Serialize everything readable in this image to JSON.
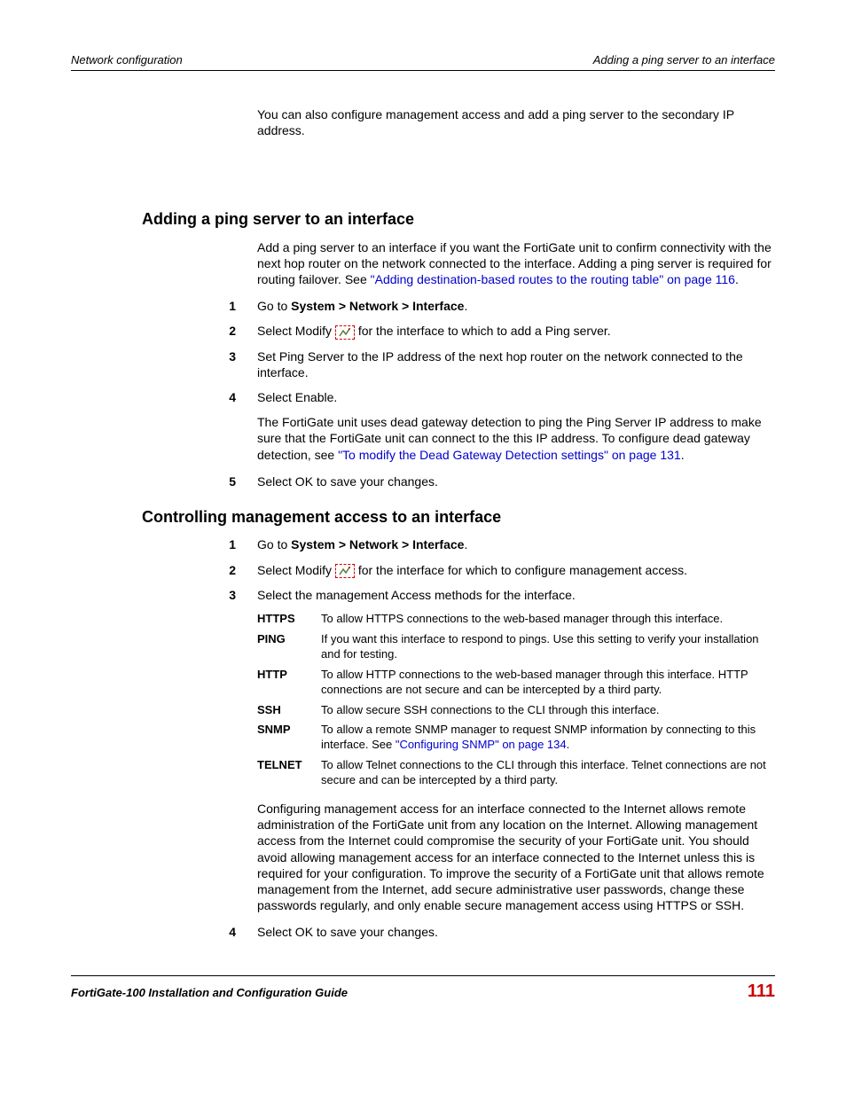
{
  "header": {
    "left": "Network configuration",
    "right": "Adding a ping server to an interface"
  },
  "intro": "You can also configure management access and add a ping server to the secondary IP address.",
  "section1": {
    "title": "Adding a ping server to an interface",
    "para_pre": "Add a ping server to an interface if you want the FortiGate unit to confirm connectivity with the next hop router on the network connected to the interface. Adding a ping server is required for routing failover. See ",
    "para_link": "\"Adding destination-based routes to the routing table\" on page 116",
    "para_post": ".",
    "step1_pre": "Go to ",
    "step1_bold": "System > Network > Interface",
    "step1_post": ".",
    "step2_pre": "Select Modify ",
    "step2_post": " for the interface to which to add a Ping server.",
    "step3": "Set Ping Server to the IP address of the next hop router on the network connected to the interface.",
    "step4": "Select Enable.",
    "step4_sub_pre": "The FortiGate unit uses dead gateway detection to ping the Ping Server IP address to make sure that the FortiGate unit can connect to the this IP address. To configure dead gateway detection, see ",
    "step4_sub_link": "\"To modify the Dead Gateway Detection settings\" on page 131",
    "step4_sub_post": ".",
    "step5": "Select OK to save your changes."
  },
  "section2": {
    "title": "Controlling management access to an interface",
    "step1_pre": "Go to ",
    "step1_bold": "System > Network > Interface",
    "step1_post": ".",
    "step2_pre": "Select Modify ",
    "step2_post": " for the interface for which to configure management access.",
    "step3": "Select the management Access methods for the interface.",
    "access": {
      "https": {
        "label": "HTTPS",
        "desc": "To allow HTTPS connections to the web-based manager through this interface."
      },
      "ping": {
        "label": "PING",
        "desc": "If you want this interface to respond to pings. Use this setting to verify your installation and for testing."
      },
      "http": {
        "label": "HTTP",
        "desc": "To allow HTTP connections to the web-based manager through this interface. HTTP connections are not secure and can be intercepted by a third party."
      },
      "ssh": {
        "label": "SSH",
        "desc": "To allow secure SSH connections to the CLI through this interface."
      },
      "snmp": {
        "label": "SNMP",
        "desc_pre": "To allow a remote SNMP manager to request SNMP information by connecting to this interface. See ",
        "desc_link": "\"Configuring SNMP\" on page 134",
        "desc_post": "."
      },
      "telnet": {
        "label": "TELNET",
        "desc": "To allow Telnet connections to the CLI through this interface. Telnet connections are not secure and can be intercepted by a third party."
      }
    },
    "closing": "Configuring management access for an interface connected to the Internet allows remote administration of the FortiGate unit from any location on the Internet. Allowing management access from the Internet could compromise the security of your FortiGate unit. You should avoid allowing management access for an interface connected to the Internet unless this is required for your configuration. To improve the security of a FortiGate unit that allows remote management from the Internet, add secure administrative user passwords, change these passwords regularly, and only enable secure management access using HTTPS or SSH.",
    "step4": "Select OK to save your changes."
  },
  "footer": {
    "left": "FortiGate-100 Installation and Configuration Guide",
    "right": "111"
  },
  "nums": {
    "n1": "1",
    "n2": "2",
    "n3": "3",
    "n4": "4",
    "n5": "5"
  }
}
